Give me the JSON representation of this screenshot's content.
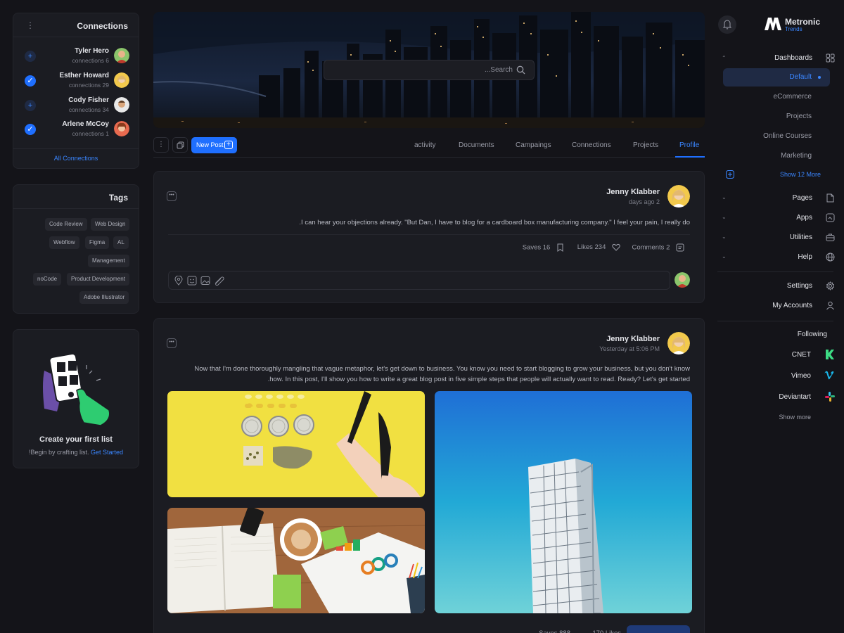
{
  "connections": {
    "title": "Connections",
    "items": [
      {
        "name": "Tyler Hero",
        "count": "connections 6",
        "status": "add"
      },
      {
        "name": "Esther Howard",
        "count": "connections 29",
        "status": "connected"
      },
      {
        "name": "Cody Fisher",
        "count": "connections 34",
        "status": "add"
      },
      {
        "name": "Arlene McCoy",
        "count": "connections 1",
        "status": "connected"
      }
    ],
    "all_link": "All Connections"
  },
  "tags": {
    "title": "Tags",
    "items": [
      "Code Review",
      "Web Design",
      "Webflow",
      "Figma",
      "AL",
      "Management",
      "noCode",
      "Product Development",
      "Adobe Illustrator"
    ]
  },
  "create_list": {
    "title": "Create your first list",
    "text": "!Begin by crafting list.",
    "link": "Get Started"
  },
  "search": {
    "placeholder": "...Search"
  },
  "toolbar": {
    "new_post": "New Post",
    "tabs": [
      "activity",
      "Documents",
      "Campaings",
      "Connections",
      "Projects",
      "Profile"
    ],
    "active_tab": "Profile"
  },
  "posts": [
    {
      "author": "Jenny Klabber",
      "time": "days ago 2",
      "body": ".I can hear your objections already. \"But Dan, I have to blog for a cardboard box manufacturing company.\" I feel your pain, I really do",
      "saves": "Saves 16",
      "likes": "Likes 234",
      "comments": "Comments 2"
    },
    {
      "author": "Jenny Klabber",
      "time": "Yesterday at 5:06 PM",
      "body_line1": "Now that I'm done thoroughly mangling that vague metaphor, let's get down to business. You know you need to start blogging to grow your business, but you don't know",
      "body_line2": ".how. In this post, I'll show you how to write a great blog post in five simple steps that people will actually want to read. Ready? Let's get started"
    }
  ],
  "sidebar": {
    "brand": "Metronic",
    "brand_sub": "Trends",
    "dashboards": "Dashboards",
    "dash_items": [
      "Default",
      "eCommerce",
      "Projects",
      "Online Courses",
      "Marketing"
    ],
    "show_more": "Show 12 More",
    "sections": [
      "Pages",
      "Apps",
      "Utilities",
      "Help"
    ],
    "settings": "Settings",
    "accounts": "My Accounts",
    "following_title": "Following",
    "following": [
      "CNET",
      "Vimeo",
      "Deviantart"
    ],
    "following_more": "Show more"
  },
  "colors": {
    "accent": "#1f6fff",
    "bg": "#141419",
    "card": "#1b1c22"
  }
}
